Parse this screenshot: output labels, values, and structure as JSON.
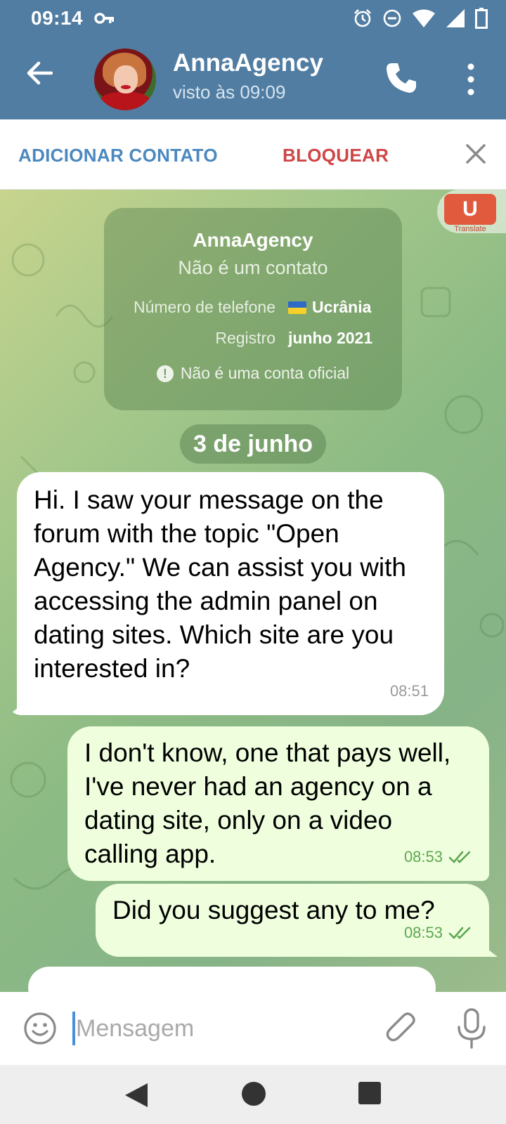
{
  "status_bar": {
    "time": "09:14",
    "icons": [
      "key-icon",
      "alarm-icon",
      "dnd-icon",
      "wifi-icon",
      "signal-icon",
      "battery-icon"
    ]
  },
  "header": {
    "contact_name": "AnnaAgency",
    "last_seen": "visto às 09:09",
    "icons": [
      "back-arrow-icon",
      "phone-icon",
      "more-vertical-icon"
    ],
    "color": "#517da2"
  },
  "action_bar": {
    "add_contact_label": "ADICIONAR CONTATO",
    "block_label": "BLOQUEAR",
    "add_contact_color": "#4b88bf",
    "block_color": "#cf4646"
  },
  "translate_widget": {
    "logo_letter": "U",
    "label": "Translate"
  },
  "info_card": {
    "name": "AnnaAgency",
    "status": "Não é um contato",
    "phone_label": "Número de telefone",
    "phone_value": "Ucrânia",
    "registration_label": "Registro",
    "registration_value": "junho 2021",
    "warning": "Não é uma conta oficial"
  },
  "date_separator": "3 de junho",
  "messages": [
    {
      "direction": "incoming",
      "text": "Hi. I saw your message on the forum with the topic \"Open Agency.\" We can assist you with accessing the admin panel on dating sites. Which site are you interested in?",
      "time": "08:51"
    },
    {
      "direction": "outgoing",
      "text": "I don't know, one that pays well, I've never had an agency on a dating site, only on a video calling app.",
      "time": "08:53",
      "read": true
    },
    {
      "direction": "outgoing",
      "text": "Did you suggest any to me?",
      "time": "08:53",
      "read": true
    }
  ],
  "composer": {
    "placeholder": "Mensagem",
    "value": "",
    "icons": [
      "emoji-icon",
      "paperclip-icon",
      "microphone-icon"
    ]
  },
  "colors": {
    "incoming_bubble": "#ffffff",
    "outgoing_bubble": "#efffde",
    "read_check": "#5ea651"
  }
}
